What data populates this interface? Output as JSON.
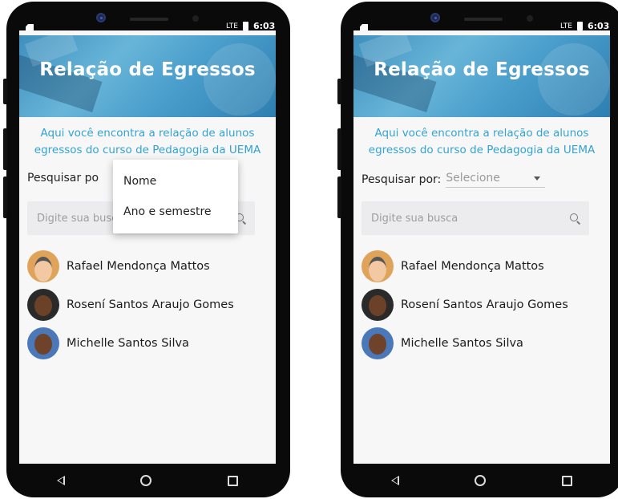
{
  "screens": [
    {
      "status": {
        "time": "6:03",
        "signal": "LTE"
      },
      "header": {
        "title": "Relação de Egressos"
      },
      "subtitle": "Aqui você encontra a relação de alunos egressos do curso de Pedagogia da UEMA",
      "search": {
        "label": "Pesquisar por:",
        "label_visible": "Pesquisar po",
        "select_value": "",
        "placeholder": "Digite sua busca",
        "placeholder_visible": "Digite sua bu"
      },
      "dropdown": {
        "open": true,
        "options": [
          "Nome",
          "Ano e semestre"
        ]
      },
      "people": [
        "Rafael Mendonça Mattos",
        "Rosení Santos Araujo Gomes",
        "Michelle Santos Silva"
      ]
    },
    {
      "status": {
        "time": "6:03",
        "signal": "LTE"
      },
      "header": {
        "title": "Relação de Egressos"
      },
      "subtitle": "Aqui você encontra a relação de alunos egressos do curso de Pedagogia da UEMA",
      "search": {
        "label": "Pesquisar por:",
        "select_value": "Selecione",
        "placeholder": "Digite sua busca"
      },
      "dropdown": {
        "open": false
      },
      "people": [
        "Rafael Mendonça Mattos",
        "Rosení Santos Araujo Gomes",
        "Michelle Santos Silva"
      ]
    }
  ],
  "nav": {
    "icons": [
      "back-icon",
      "home-icon",
      "recents-icon"
    ]
  },
  "colors": {
    "accent": "#33a3d1",
    "banner": "#4b9fcc",
    "screen_bg": "#f7f7f8"
  }
}
